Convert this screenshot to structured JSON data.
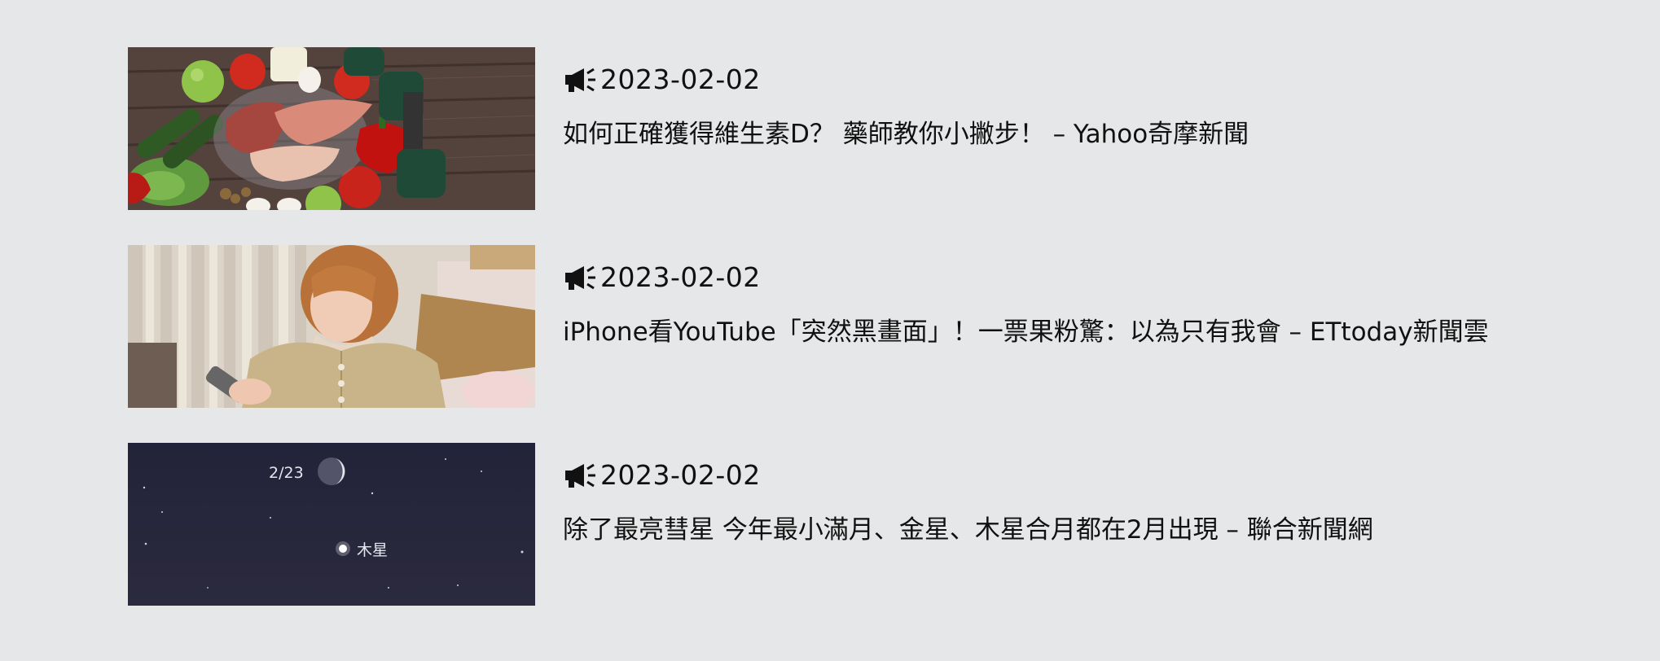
{
  "news": [
    {
      "date": "2023-02-02",
      "title": "如何正確獲得維生素D？ 藥師教你小撇步！ – Yahoo奇摩新聞",
      "thumb_icon": "food-photo"
    },
    {
      "date": "2023-02-02",
      "title": "iPhone看YouTube「突然黑畫面」！一票果粉驚：以為只有我會 – ETtoday新聞雲",
      "thumb_icon": "person-phone-photo"
    },
    {
      "date": "2023-02-02",
      "title": "除了最亮彗星 今年最小滿月、金星、木星合月都在2月出現 – 聯合新聞網",
      "thumb_icon": "night-sky-photo",
      "thumb_labels": {
        "moon_date": "2/23",
        "planet": "木星"
      }
    }
  ],
  "colors": {
    "background": "#e5e7e8",
    "text": "#111111",
    "sky": "#25263a"
  }
}
